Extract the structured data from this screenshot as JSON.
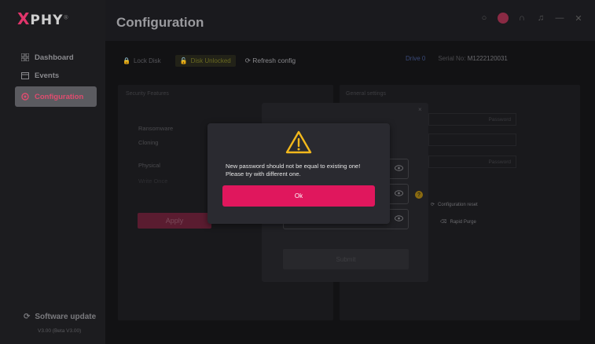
{
  "app": {
    "logo_text": "PHY",
    "logo_mark": "X",
    "logo_reg": "®"
  },
  "header": {
    "title": "Configuration",
    "icons": [
      "status-dot-icon",
      "alert-badge-icon",
      "headset-icon",
      "bell-icon",
      "minimize-icon",
      "close-icon"
    ]
  },
  "sidebar": {
    "items": [
      {
        "label": "Dashboard",
        "icon": "grid-icon",
        "active": false
      },
      {
        "label": "Events",
        "icon": "calendar-icon",
        "active": false
      },
      {
        "label": "Configuration",
        "icon": "gear-icon",
        "active": true
      }
    ],
    "software_update": "Software update",
    "version": "V3.00 (Beta V3.00)"
  },
  "toolbar": {
    "lock_label": "Lock Disk",
    "unlock_label": "Disk Unlocked",
    "refresh_label": "Refresh config",
    "drive_label": "Drive 0",
    "serial_label": "Serial No:",
    "serial_value": "M1222120031"
  },
  "security_panel": {
    "title": "Security Features",
    "items": [
      "Ransomware",
      "Cloning",
      "Physical",
      "Write Once"
    ],
    "apply_label": "Apply"
  },
  "general_panel": {
    "title": "General settings",
    "rows": [
      "Password",
      "",
      "Password"
    ],
    "config_reset_label": "Configuration reset",
    "rapid_purge_label": "Rapid Purge"
  },
  "password_modal": {
    "close_glyph": "×",
    "submit_label": "Submit",
    "help_glyph": "?"
  },
  "alert": {
    "line1": "New password should not be equal to existing one!",
    "line2": "Please try with different one.",
    "ok_label": "Ok",
    "accent": "#e0175d"
  }
}
